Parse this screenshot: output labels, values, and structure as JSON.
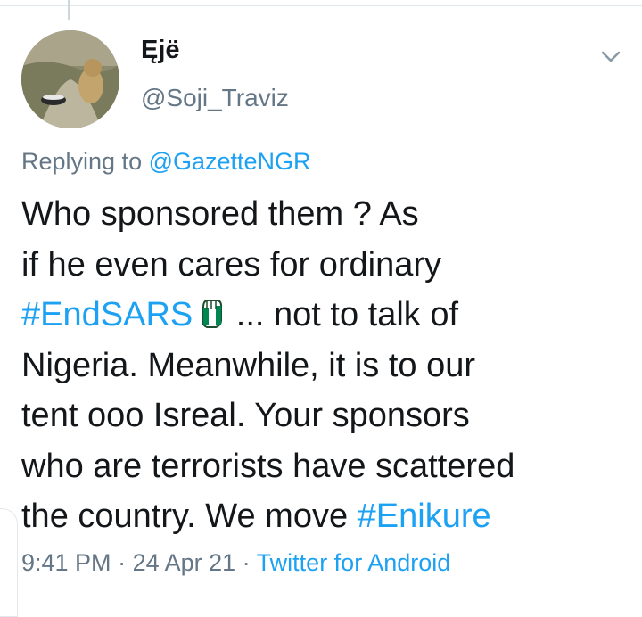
{
  "tweet": {
    "author_name": "Ęjë",
    "author_handle": "@Soji_Traviz",
    "avatar_icon": "avatar-photo-lion-and-honey-badger",
    "menu_icon": "chevron-down-icon",
    "reply_prefix": "Replying to ",
    "reply_to": "@GazetteNGR",
    "text_lines": [
      {
        "plain": "Who sponsored them  ? As"
      },
      {
        "plain": "if he even cares for ordinary"
      },
      {
        "tag": "#EndSARS",
        "after": "  ... not to talk of",
        "emoji": "raised-fist-nigeria-flag-icon"
      },
      {
        "plain": "Nigeria.  Meanwhile,  it is to our"
      },
      {
        "plain": "tent ooo Isreal.  Your sponsors"
      },
      {
        "plain": "who are terrorists have scattered"
      },
      {
        "before": "the country. We move ",
        "tag": "#Enikure"
      }
    ],
    "time": "9:41 PM",
    "separator": " · ",
    "date": "24 Apr 21",
    "source": "Twitter for Android"
  },
  "colors": {
    "link": "#1da1f2",
    "secondary_text": "#657786",
    "primary_text": "#14171a",
    "border": "#e1e8ed",
    "flag_green": "#008751"
  }
}
